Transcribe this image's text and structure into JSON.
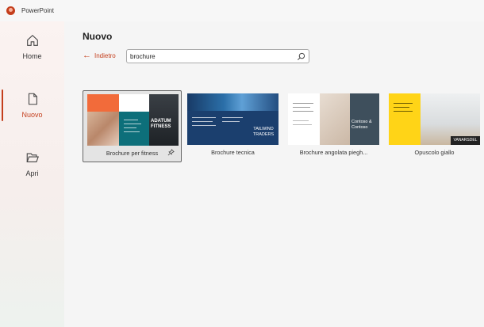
{
  "app": {
    "title": "PowerPoint"
  },
  "sidebar": {
    "items": [
      {
        "label": "Home",
        "icon": "home-icon",
        "active": false
      },
      {
        "label": "Nuovo",
        "icon": "new-document-icon",
        "active": true
      },
      {
        "label": "Apri",
        "icon": "folder-open-icon",
        "active": false
      }
    ]
  },
  "main": {
    "title": "Nuovo",
    "back_label": "Indietro",
    "search": {
      "value": "brochure",
      "placeholder": ""
    },
    "templates": [
      {
        "label": "Brochure per fitness",
        "selected": true,
        "thumb_text": "ADATUM FITNESS"
      },
      {
        "label": "Brochure tecnica",
        "selected": false,
        "thumb_text": "TAILWIND TRADERS"
      },
      {
        "label": "Brochure angolata piegh...",
        "selected": false,
        "thumb_text": "Contoso & Contoso"
      },
      {
        "label": "Opuscolo giallo",
        "selected": false,
        "thumb_text": "VANARSDEL"
      }
    ]
  },
  "colors": {
    "accent": "#c43e1c"
  }
}
